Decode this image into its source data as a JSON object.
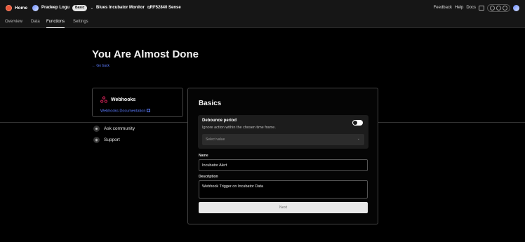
{
  "topbar": {
    "home_label": "Home",
    "user_name": "Pradeep Logu",
    "plan_badge": "Basic",
    "project_name": "Blues Incubator Monitor",
    "device_name": "nRF52840 Sense",
    "links": [
      "Feedback",
      "Help",
      "Docs"
    ],
    "icons": [
      "home-logo-icon",
      "user-avatar-icon",
      "chevron-down-icon",
      "terminal-icon",
      "theme-toggle-icon",
      "profile-avatar-icon"
    ]
  },
  "tabs": [
    {
      "label": "Overview",
      "active": false
    },
    {
      "label": "Data",
      "active": false
    },
    {
      "label": "Functions",
      "active": true
    },
    {
      "label": "Settings",
      "active": false
    }
  ],
  "page": {
    "title": "You Are Almost Done",
    "go_back": "← Go back"
  },
  "webhook_card": {
    "title": "Webhooks",
    "doc_link": "Webhooks Documentation"
  },
  "side_links": [
    {
      "label": "Ask community",
      "icon": "community-icon"
    },
    {
      "label": "Support",
      "icon": "support-icon"
    }
  ],
  "form": {
    "title": "Basics",
    "debounce": {
      "title": "Debounce period",
      "description": "Ignore action within the chosen time frame.",
      "toggle_on": true,
      "select_placeholder": "Select value"
    },
    "name_label": "Name",
    "name_value": "Incubator Alert",
    "description_label": "Description",
    "description_value": "Webhook Trigger on Incubator Data",
    "next_label": "Next"
  },
  "colors": {
    "accent_link": "#5b7cff",
    "logo": "#e8573a",
    "webhook_icon": "#e0245e"
  }
}
